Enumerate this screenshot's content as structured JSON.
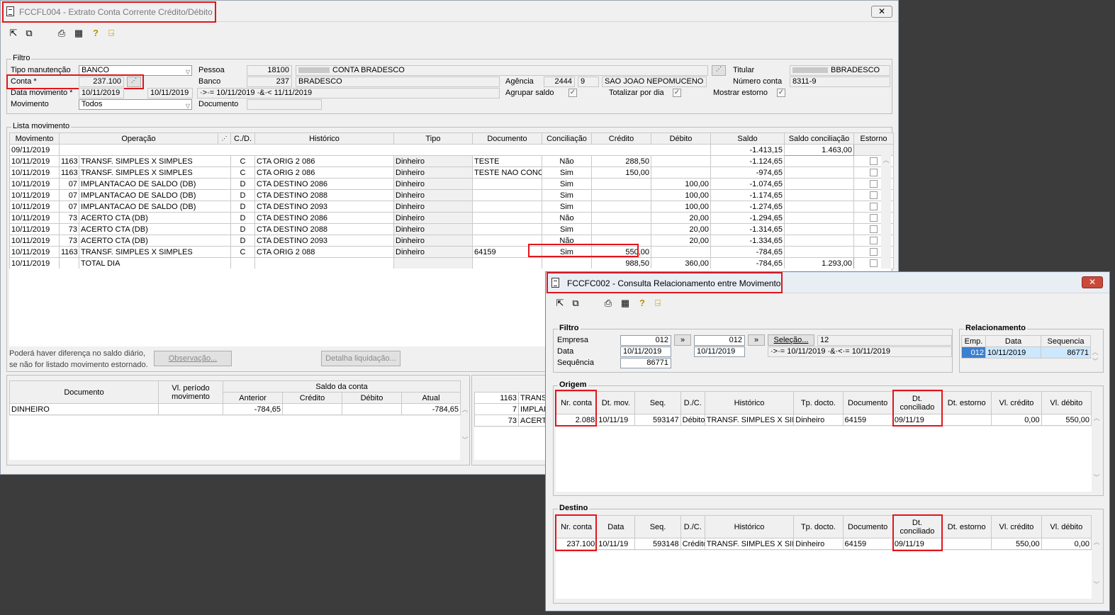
{
  "main": {
    "title": "FCCFL004 - Extrato Conta Corrente Crédito/Débito",
    "close": "✕",
    "filtro": {
      "group_title": "Filtro",
      "tipo_manutencao_label": "Tipo manutenção",
      "tipo_manutencao_value": "BANCO",
      "conta_label": "Conta *",
      "conta_value": "237.100",
      "data_movimento_label": "Data movimento *",
      "data_inicio": "10/11/2019",
      "data_fim": "10/11/2019",
      "data_expr": "·>·= 10/11/2019 ·&·< 11/11/2019",
      "movimento_label": "Movimento",
      "movimento_value": "Todos",
      "pessoa_label": "Pessoa",
      "pessoa_code": "18100",
      "pessoa_name": "CONTA BRADESCO",
      "banco_label": "Banco",
      "banco_code": "237",
      "banco_name": "BRADESCO",
      "documento_label": "Documento",
      "agencia_label": "Agência",
      "agencia_code": "2444",
      "agencia_dv": "9",
      "agencia_name": "SAO JOAO NEPOMUCENO",
      "agrupar_saldo_label": "Agrupar saldo",
      "totalizar_label": "Totalizar por dia",
      "mostrar_estorno_label": "Mostrar estorno",
      "titular_label": "Titular",
      "titular_value": "BBRADESCO",
      "numero_conta_label": "Número conta",
      "numero_conta_value": "8311-9"
    },
    "lista": {
      "group_title": "Lista movimento",
      "columns": [
        "Movimento",
        "Operação",
        "",
        "C./D.",
        "Histórico",
        "Tipo",
        "Documento",
        "Conciliação",
        "Crédito",
        "Débito",
        "Saldo",
        "Saldo conciliação",
        "Estorno"
      ],
      "first_row": {
        "date": "09/11/2019",
        "saldo": "-1.413,15",
        "saldo_conc": "1.463,00"
      },
      "rows": [
        {
          "mov": "10/11/2019",
          "cod": "1163",
          "op": "TRANSF. SIMPLES X SIMPLES",
          "cd": "C",
          "hist": "CTA ORIG  2 086",
          "tipo": "Dinheiro",
          "doc": "TESTE",
          "conc": "Não",
          "cred": "288,50",
          "deb": "",
          "saldo": "-1.124,65"
        },
        {
          "mov": "10/11/2019",
          "cod": "1163",
          "op": "TRANSF. SIMPLES X SIMPLES",
          "cd": "C",
          "hist": "CTA ORIG  2 086",
          "tipo": "Dinheiro",
          "doc": "TESTE NAO CONCI",
          "conc": "Sim",
          "cred": "150,00",
          "deb": "",
          "saldo": "-974,65"
        },
        {
          "mov": "10/11/2019",
          "cod": "07",
          "op": "IMPLANTACAO DE SALDO (DB)",
          "cd": "D",
          "hist": "CTA DESTINO  2086",
          "tipo": "Dinheiro",
          "doc": "",
          "conc": "Sim",
          "cred": "",
          "deb": "100,00",
          "saldo": "-1.074,65"
        },
        {
          "mov": "10/11/2019",
          "cod": "07",
          "op": "IMPLANTACAO DE SALDO (DB)",
          "cd": "D",
          "hist": "CTA DESTINO  2088",
          "tipo": "Dinheiro",
          "doc": "",
          "conc": "Sim",
          "cred": "",
          "deb": "100,00",
          "saldo": "-1.174,65"
        },
        {
          "mov": "10/11/2019",
          "cod": "07",
          "op": "IMPLANTACAO DE SALDO (DB)",
          "cd": "D",
          "hist": "CTA DESTINO  2093",
          "tipo": "Dinheiro",
          "doc": "",
          "conc": "Sim",
          "cred": "",
          "deb": "100,00",
          "saldo": "-1.274,65"
        },
        {
          "mov": "10/11/2019",
          "cod": "73",
          "op": "ACERTO CTA (DB)",
          "cd": "D",
          "hist": "CTA DESTINO  2086",
          "tipo": "Dinheiro",
          "doc": "",
          "conc": "Não",
          "cred": "",
          "deb": "20,00",
          "saldo": "-1.294,65"
        },
        {
          "mov": "10/11/2019",
          "cod": "73",
          "op": "ACERTO CTA (DB)",
          "cd": "D",
          "hist": "CTA DESTINO  2088",
          "tipo": "Dinheiro",
          "doc": "",
          "conc": "Sim",
          "cred": "",
          "deb": "20,00",
          "saldo": "-1.314,65"
        },
        {
          "mov": "10/11/2019",
          "cod": "73",
          "op": "ACERTO CTA (DB)",
          "cd": "D",
          "hist": "CTA DESTINO  2093",
          "tipo": "Dinheiro",
          "doc": "",
          "conc": "Não",
          "cred": "",
          "deb": "20,00",
          "saldo": "-1.334,65"
        },
        {
          "mov": "10/11/2019",
          "cod": "1163",
          "op": "TRANSF. SIMPLES X SIMPLES",
          "cd": "C",
          "hist": "CTA ORIG  2 088",
          "tipo": "Dinheiro",
          "doc": "64159",
          "conc": "Sim",
          "cred": "550,00",
          "deb": "",
          "saldo": "-784,65"
        }
      ],
      "total_row": {
        "mov": "10/11/2019",
        "op": "TOTAL DIA",
        "cred": "988,50",
        "deb": "360,00",
        "saldo": "-784,65",
        "saldo_conc": "1.293,00"
      },
      "note_line1": "Poderá haver diferença no saldo diário,",
      "note_line2": "se não for listado movimento estornado.",
      "observacao_btn": "Observação...",
      "detalha_btn": "Detalha liquidação..."
    },
    "saldo_table": {
      "documento": "Documento",
      "vl_periodo": "Vl. período movimento",
      "saldo_conta": "Saldo da conta",
      "anterior": "Anterior",
      "credito": "Crédito",
      "debito": "Débito",
      "atual": "Atual",
      "row": {
        "doc": "DINHEIRO",
        "anterior": "-784,65",
        "atual": "-784,65"
      }
    },
    "side_list": [
      {
        "cod": "1163",
        "txt": "TRANS"
      },
      {
        "cod": "7",
        "txt": "IMPLAN"
      },
      {
        "cod": "73",
        "txt": "ACERT"
      }
    ]
  },
  "dialog": {
    "title": "FCCFC002 - Consulta Relacionamento entre Movimento",
    "close": "✕",
    "filtro": {
      "group_title": "Filtro",
      "empresa_label": "Empresa",
      "empresa_from": "012",
      "empresa_to": "012",
      "data_label": "Data",
      "data_from": "10/11/2019",
      "data_to": "10/11/2019",
      "sequencia_label": "Sequência",
      "sequencia_value": "86771",
      "arrow": "»",
      "selecao_btn": "Seleção...",
      "selecao_value": "12",
      "data_expr": "·>·= 10/11/2019 ·&·<·= 10/11/2019"
    },
    "relacionamento": {
      "group_title": "Relacionamento",
      "columns": [
        "Emp.",
        "Data",
        "Sequencia"
      ],
      "row": {
        "emp": "012",
        "data": "10/11/2019",
        "seq": "86771"
      }
    },
    "columns": [
      "Nr. conta",
      "Dt. mov.",
      "Seq.",
      "D./C.",
      "Histórico",
      "Tp. docto.",
      "Documento",
      "Dt. conciliado",
      "Dt. estorno",
      "Vl. crédito",
      "Vl. débito"
    ],
    "destino_columns": [
      "Nr. conta",
      "Data",
      "Seq.",
      "D./C.",
      "Histórico",
      "Tp. docto.",
      "Documento",
      "Dt. conciliado",
      "Dt. estorno",
      "Vl. crédito",
      "Vl. débito"
    ],
    "origem": {
      "group_title": "Origem",
      "row": {
        "conta": "2.088",
        "dt": "10/11/19",
        "seq": "593147",
        "dc": "Débito",
        "hist": "TRANSF. SIMPLES X SIMF",
        "tp": "Dinheiro",
        "doc": "64159",
        "dtconc": "09/11/19",
        "dtest": "",
        "vcred": "0,00",
        "vdeb": "550,00"
      }
    },
    "destino": {
      "group_title": "Destino",
      "row": {
        "conta": "237.100",
        "dt": "10/11/19",
        "seq": "593148",
        "dc": "Crédito",
        "hist": "TRANSF. SIMPLES X SIMF",
        "tp": "Dinheiro",
        "doc": "64159",
        "dtconc": "09/11/19",
        "dtest": "",
        "vcred": "550,00",
        "vdeb": "0,00"
      }
    }
  },
  "colors": {
    "highlight": "#e1161c",
    "selection": "#cce8ff",
    "window_bg": "#f0f0f0"
  }
}
